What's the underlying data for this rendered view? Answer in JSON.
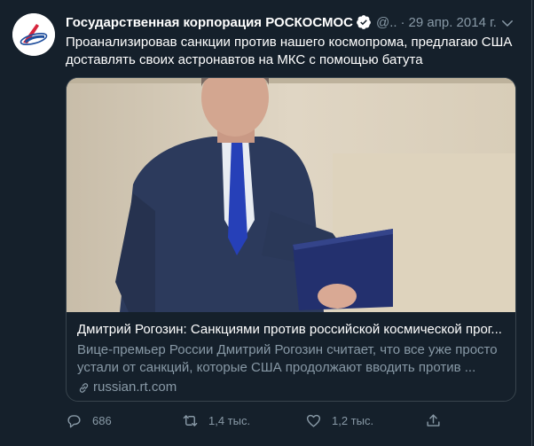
{
  "tweet": {
    "author_name": "Государственная корпорация РОСКОСМОС",
    "handle": "@..",
    "separator": "·",
    "date": "29 апр. 2014 г.",
    "text_line1": "Проанализировав санкции против нашего космопрома, предлагаю США",
    "text_line2": "доставлять своих астронавтов на МКС с помощью батута"
  },
  "card": {
    "title": "Дмитрий Рогозин: Санкциями против российской космической прог...",
    "description_line1": "Вице-премьер России Дмитрий Рогозин считает, что все уже просто",
    "description_line2": "устали от санкций, которые США продолжают вводить против ...",
    "domain": "russian.rt.com"
  },
  "actions": {
    "replies": "686",
    "retweets": "1,4 тыс.",
    "likes": "1,2 тыс."
  },
  "colors": {
    "background": "#15202b",
    "secondary_text": "#8899a6",
    "border": "#38444d",
    "brand_red": "#d7263d",
    "brand_blue": "#1f4e9c"
  },
  "icons": {
    "avatar": "roscosmos-logo",
    "verified": "verified-badge-icon",
    "menu": "chevron-down-icon",
    "link": "link-icon",
    "reply": "reply-icon",
    "retweet": "retweet-icon",
    "like": "heart-icon",
    "share": "share-icon"
  }
}
